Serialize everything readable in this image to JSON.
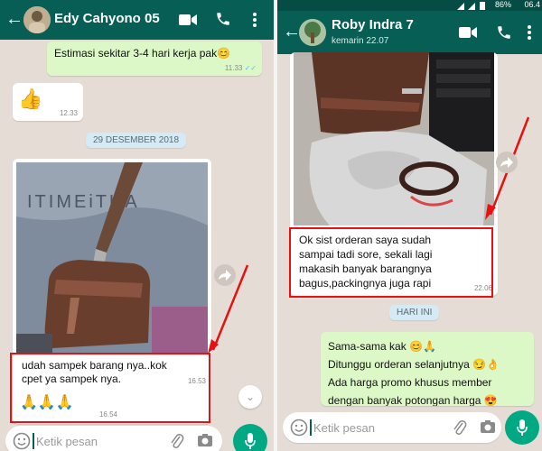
{
  "left_chat": {
    "contact_name": "Edy Cahyono 05",
    "messages": {
      "estimate_text": "Estimasi sekitar 3-4 hari kerja pak😊",
      "estimate_time": "11.33",
      "estimate_ticks": "✓✓",
      "thumb_emoji": "👍",
      "thumb_time": "12.33",
      "date_label": "29 DESEMBER 2018",
      "photo_caption": "udah sampek barang nya..kok\ncpet ya sampek nya.",
      "photo_caption_time": "16.53",
      "pray_emoji": "🙏🙏🙏",
      "pray_time": "16.54"
    },
    "input_placeholder": "Ketik pesan"
  },
  "right_chat": {
    "status_bar": {
      "battery": "86%",
      "clock": "06.4"
    },
    "contact_name": "Roby Indra 7",
    "last_seen": "kemarin 22.07",
    "messages": {
      "photo_caption": "Ok sist orderan saya sudah\nsampai tadi sore, sekali lagi\nmakasih banyak barangnya\nbagus,packingnya juga rapi",
      "photo_caption_time": "22.06",
      "date_label": "HARI INI",
      "reply_lines": [
        "Sama-sama kak 😊🙏",
        "Ditunggu orderan selanjutnya 😏👌",
        "Ada harga promo khusus member",
        "dengan banyak potongan harga 😍"
      ]
    },
    "input_placeholder": "Ketik pesan"
  },
  "colors": {
    "header": "#075e54",
    "chat_background": "#e5ddd5",
    "outgoing_bubble": "#dcf8c6",
    "incoming_bubble": "#ffffff",
    "highlight_box": "#e81010",
    "mic_button": "#00a884"
  }
}
